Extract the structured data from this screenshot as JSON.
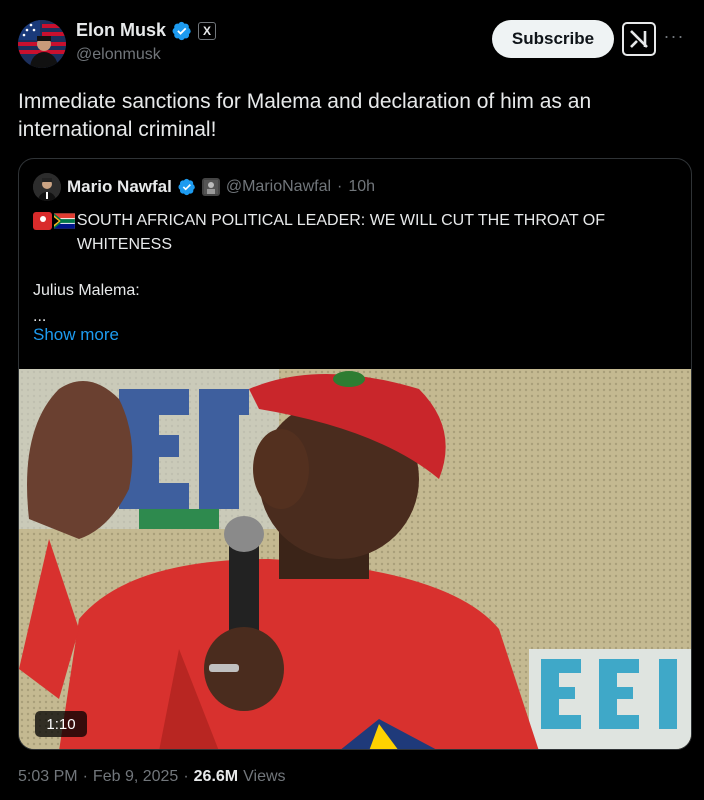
{
  "author": {
    "name": "Elon Musk",
    "handle": "@elonmusk",
    "x_badge": "X"
  },
  "actions": {
    "subscribe_label": "Subscribe",
    "more_label": "···"
  },
  "tweet": {
    "text": "Immediate sanctions for Malema and declaration of him as an international criminal!"
  },
  "quote": {
    "name": "Mario Nawfal",
    "handle": "@MarioNawfal",
    "separator": "·",
    "time": "10h",
    "line1": "SOUTH AFRICAN POLITICAL LEADER: WE WILL CUT THE THROAT OF WHITENESS",
    "line2": "Julius Malema:",
    "line3": "...",
    "show_more": "Show more",
    "video_duration": "1:10"
  },
  "meta": {
    "time": "5:03 PM",
    "sep1": "·",
    "date": "Feb 9, 2025",
    "sep2": "·",
    "views_count": "26.6M",
    "views_label": "Views"
  },
  "colors": {
    "background": "#000000",
    "text": "#e7e9ea",
    "muted": "#71767b",
    "link": "#1d9bf0",
    "verified": "#1d9bf0",
    "border": "#2f3336"
  },
  "icons": {
    "verified": "verified-badge-icon",
    "grok": "grok-icon",
    "more": "more-dots-icon",
    "siren": "siren-emoji-icon",
    "flag": "south-africa-flag-icon"
  }
}
